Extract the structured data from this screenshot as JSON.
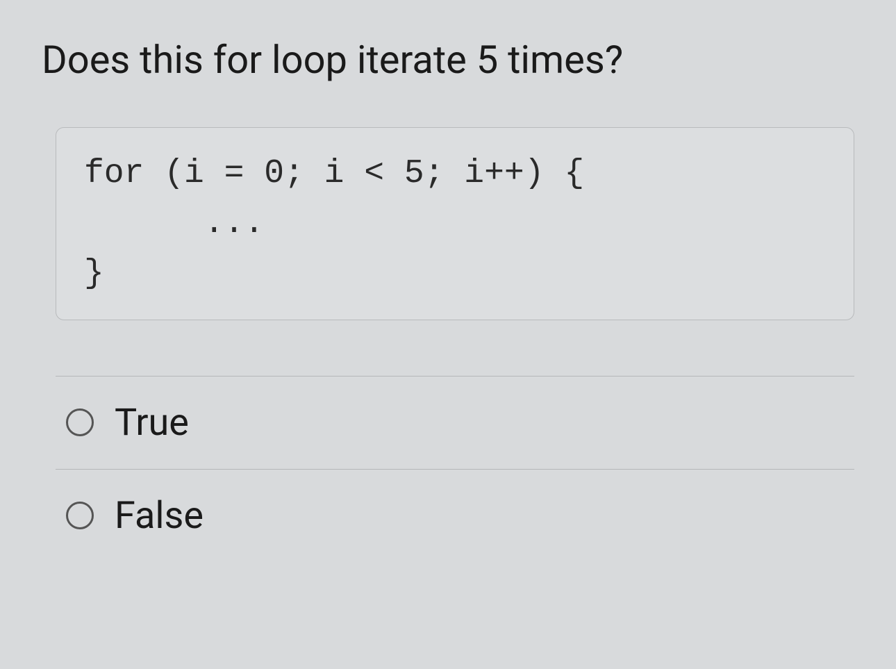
{
  "question": {
    "text": "Does this for loop iterate 5 times?",
    "code": "for (i = 0; i < 5; i++) {\n      ...\n}"
  },
  "options": [
    {
      "label": "True"
    },
    {
      "label": "False"
    }
  ]
}
